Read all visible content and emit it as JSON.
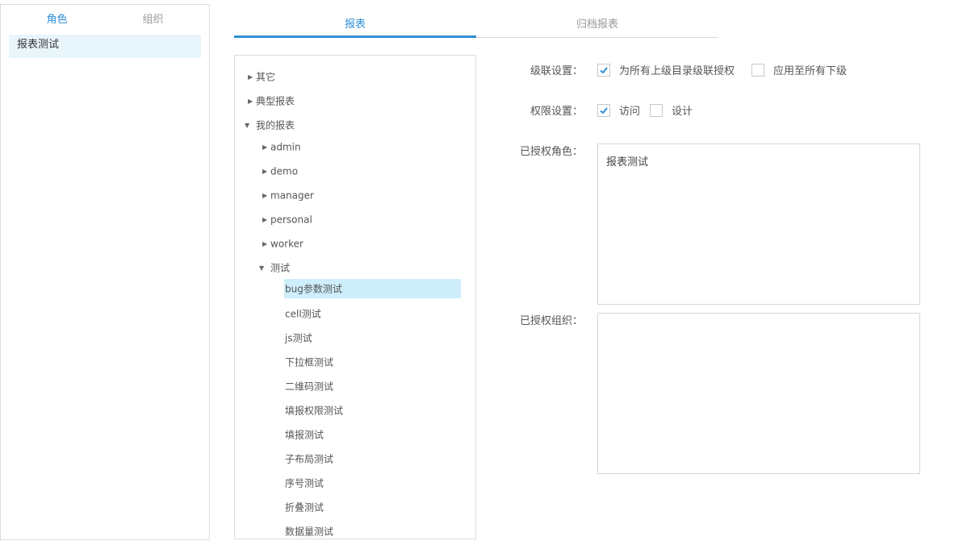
{
  "left_tabs": [
    {
      "label": "角色",
      "active": true
    },
    {
      "label": "组织",
      "active": false
    }
  ],
  "roles": [
    "报表测试"
  ],
  "main_tabs": [
    {
      "label": "报表",
      "active": true
    },
    {
      "label": "归档报表",
      "active": false
    }
  ],
  "tree": {
    "root_items": [
      "其它",
      "典型报表",
      "我的报表"
    ],
    "my_reports_children": [
      "admin",
      "demo",
      "manager",
      "personal",
      "worker",
      "测试"
    ],
    "test_children": [
      "bug参数测试",
      "cell测试",
      "js测试",
      "下拉框测试",
      "二维码测试",
      "填报权限测试",
      "填报测试",
      "子布局测试",
      "序号测试",
      "折叠测试",
      "数据量测试"
    ],
    "selected": "bug参数测试"
  },
  "form": {
    "cascade_label": "级联设置：",
    "cascade_opt1": "为所有上级目录级联授权",
    "cascade_opt1_checked": true,
    "cascade_opt2": "应用至所有下级",
    "cascade_opt2_checked": false,
    "perm_label": "权限设置：",
    "perm_opt1": "访问",
    "perm_opt1_checked": true,
    "perm_opt2": "设计",
    "perm_opt2_checked": false,
    "authorized_roles_label": "已授权角色：",
    "authorized_roles_value": "报表测试",
    "authorized_orgs_label": "已授权组织：",
    "authorized_orgs_value": ""
  },
  "colors": {
    "accent": "#2f8fd5",
    "selected_bg": "#cdeefa",
    "role_bg": "#e8f5fb"
  }
}
